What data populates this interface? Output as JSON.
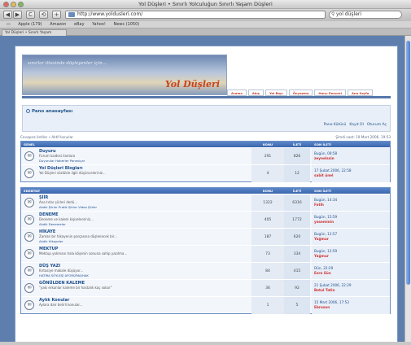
{
  "window": {
    "title": "Yol Düşleri • Sınırlı Yolculuğun Sınırlı Yaşam Düşleri"
  },
  "toolbar": {
    "back": "◀",
    "forward": "▶",
    "reload": "C",
    "add": "+",
    "url": "http://www.yoldusleri.com/",
    "rss": "RSS",
    "search_value": "yol düşleri"
  },
  "bookmarks": {
    "items": [
      "Apple (179)",
      "Amazon",
      "eBay",
      "Yahoo!",
      "News (1050)"
    ]
  },
  "tab": {
    "label": "Yol Düşleri • Sınırlı Yaşam"
  },
  "banner": {
    "tagline": "sınırlar ötesinde düşleyenler için...",
    "logo": "Yol Düşleri",
    "tabs": [
      "Arama",
      "Akış",
      "Yol Bayı",
      "Önyazma",
      "Harçı Penceri",
      "Ana Sayfa"
    ]
  },
  "pano": {
    "link": "Pano anasayfası",
    "user_links": [
      "Pano Kütüsü",
      "Kayıt Ol",
      "Oturum Aç"
    ]
  },
  "meta": {
    "left": "Cevapsız iletiler • Aktif konular",
    "right": "Şimdi saat: 19 Mart 2006, 19:53"
  },
  "sections": [
    {
      "head": {
        "title": "GENEL",
        "topics": "KONU",
        "posts": "İLETİ",
        "last": "SON İLETİ"
      },
      "rows": [
        {
          "title": "Duyuru",
          "desc": "Forum kaidesi ilanlara",
          "subs": "Duyurular  Haberler  Paneviçar",
          "topics": "291",
          "posts": "826",
          "last_time": "Bugün, 08:58",
          "last_user": "zeynelssin"
        },
        {
          "title": "Yol Düşleri Blogları",
          "desc": "Yol Düşleri sözlükle ilgili düşünceleriniz...",
          "subs": "",
          "topics": "4",
          "posts": "12",
          "last_time": "17 Şubat 2006, 22:58",
          "last_user": "sabit ünel"
        }
      ]
    },
    {
      "head": {
        "title": "EDEBİYAT",
        "topics": "KONU",
        "posts": "İLETİ",
        "last": "SON İLETİ"
      },
      "rows": [
        {
          "title": "ŞİİR",
          "desc": "Ana tırlar şiirleri derki...",
          "subs": "Akdik Şiirler  Pratik Şiirler  Video Şiirler",
          "topics": "1322",
          "posts": "6316",
          "last_time": "Bugün, 14:34",
          "last_user": "Fatih"
        },
        {
          "title": "DENEME",
          "desc": "Deneme ve kalem kişiselersiniz...",
          "subs": "Akdik Denemeler",
          "topics": "405",
          "posts": "1772",
          "last_time": "Bugün, 15:59",
          "last_user": "yaseminin"
        },
        {
          "title": "HİKAYE",
          "desc": "Zaman bir hikayenin parçasına düşlenecek bir...",
          "subs": "Akdik Hikayeler",
          "topics": "187",
          "posts": "620",
          "last_time": "Bugün, 12:57",
          "last_user": "Yağmur"
        },
        {
          "title": "MEKTUP",
          "desc": "Mektup yokmanı hala köşenin sonuna sahip yazılma...",
          "subs": "",
          "topics": "73",
          "posts": "334",
          "last_time": "Bugün, 12:59",
          "last_user": "Yağmur"
        },
        {
          "title": "DÜŞ YAZI",
          "desc": "Kırtasiye makale düşüyor...",
          "subs": "HATIRA  SÖYLEŞİ  AFORİZMA/HAK",
          "topics": "84",
          "posts": "415",
          "last_time": "Dün, 22:29",
          "last_user": "Esra Sün"
        },
        {
          "title": "GÖNÜLDEN KALEME",
          "desc": "\"yakı erkanlar kaleme bir hastalık kaç sokar\"",
          "subs": "",
          "topics": "36",
          "posts": "92",
          "last_time": "21 Şubat 2006, 22:29",
          "last_user": "Betul Tatin"
        },
        {
          "title": "Aylık Konular",
          "desc": "Aylara dair belirli konular...",
          "subs": "",
          "topics": "1",
          "posts": "5",
          "last_time": "15 Mart 2006, 17:53",
          "last_user": "Ebruson"
        }
      ]
    }
  ]
}
